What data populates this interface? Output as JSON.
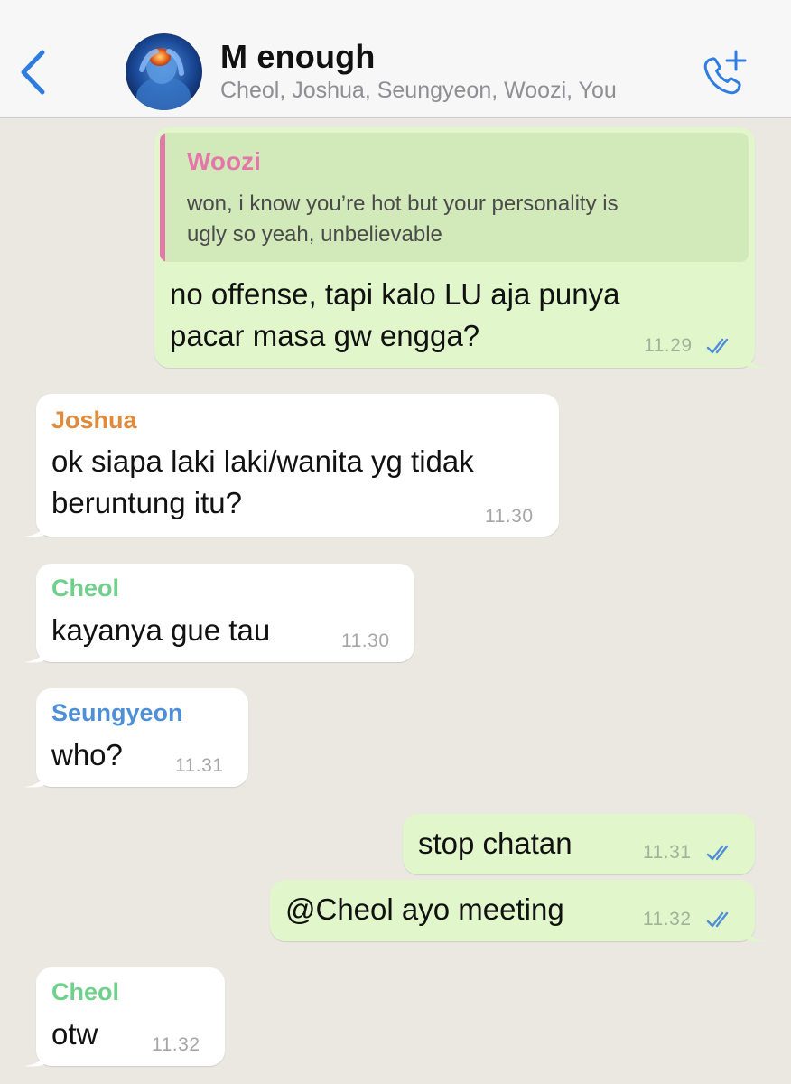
{
  "header": {
    "title": "M enough",
    "members": "Cheol, Joshua, Seungyeon, Woozi, You",
    "back_icon": "chevron-left-icon",
    "call_icon": "phone-add-icon"
  },
  "colors": {
    "accent": "#2f7de1",
    "outgoing_bubble": "#e1f7cb",
    "incoming_bubble": "#ffffff",
    "chat_background": "#ebe8e2",
    "woozi": "#e377a8",
    "joshua": "#e08a3c",
    "cheol": "#6fd08c",
    "seungyeon": "#4f8fd8"
  },
  "messages": {
    "m1": {
      "quote_sender": "Woozi",
      "quote_line1": "won, i know you’re hot but your personality is",
      "quote_line2": "ugly so yeah, unbelievable",
      "line1": "no offense, tapi kalo LU aja punya",
      "line2": "pacar masa gw engga?",
      "time": "11.29",
      "status": "read"
    },
    "m2": {
      "sender": "Joshua",
      "line1": "ok siapa laki laki/wanita yg tidak",
      "line2": "beruntung itu?",
      "time": "11.30"
    },
    "m3": {
      "sender": "Cheol",
      "text": "kayanya gue tau",
      "time": "11.30"
    },
    "m4": {
      "sender": "Seungyeon",
      "text": "who?",
      "time": "11.31"
    },
    "m5": {
      "text": "stop chatan",
      "time": "11.31",
      "status": "read"
    },
    "m6": {
      "text": "@Cheol ayo meeting",
      "time": "11.32",
      "status": "read"
    },
    "m7": {
      "sender": "Cheol",
      "text": "otw",
      "time": "11.32"
    }
  }
}
